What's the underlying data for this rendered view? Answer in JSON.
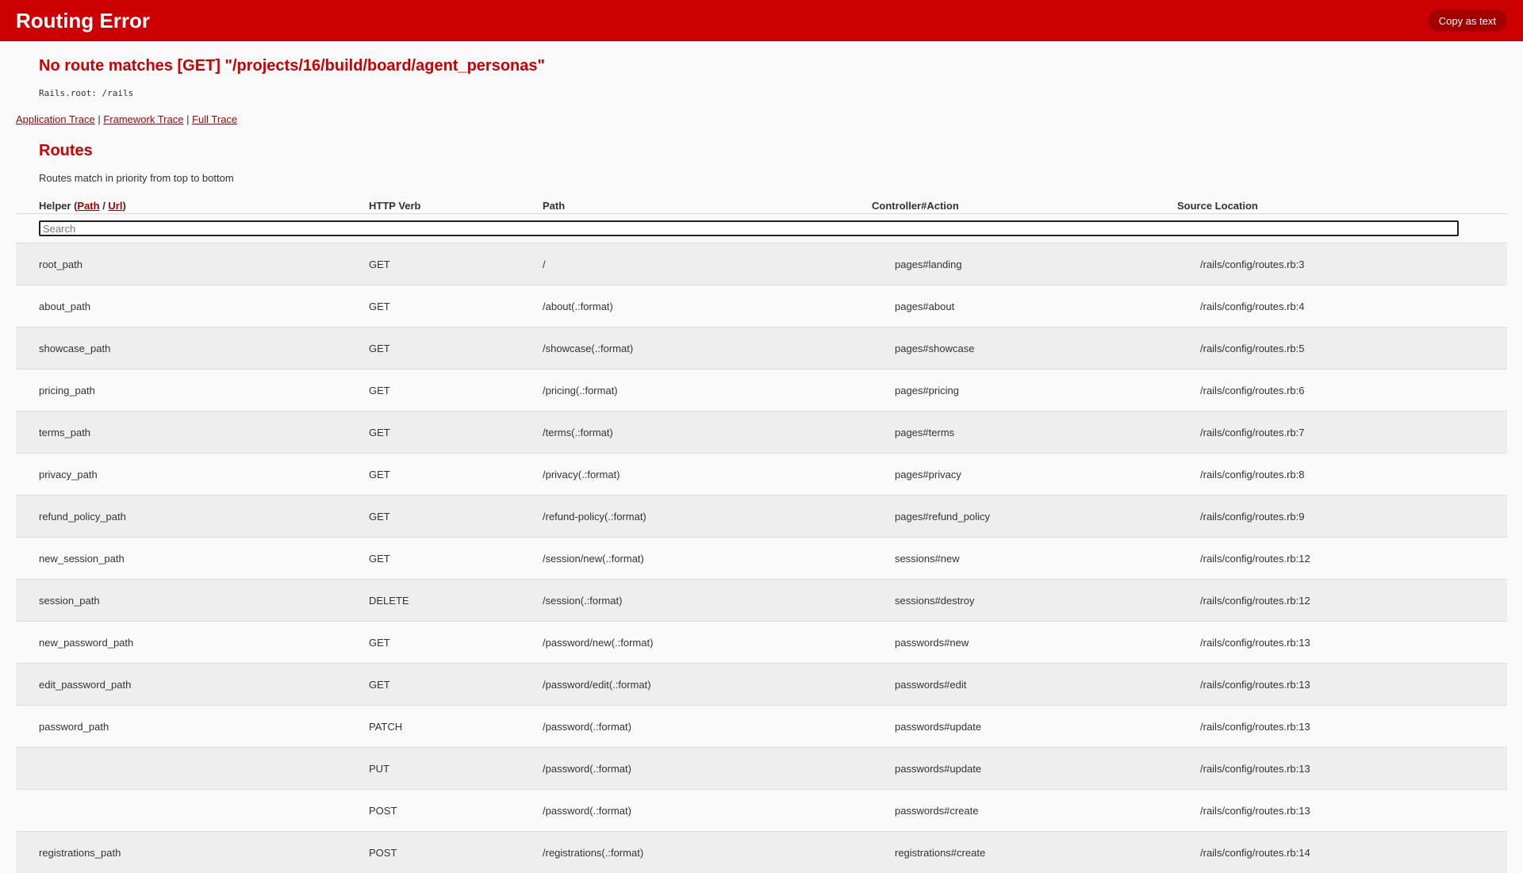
{
  "header": {
    "title": "Routing Error",
    "copy_button": "Copy as text"
  },
  "error": {
    "message": "No route matches [GET] \"/projects/16/build/board/agent_personas\"",
    "rails_root": "Rails.root: /rails"
  },
  "trace_links": {
    "application": "Application Trace",
    "framework": "Framework Trace",
    "full": "Full Trace",
    "separator": " | "
  },
  "routes": {
    "title": "Routes",
    "description": "Routes match in priority from top to bottom",
    "columns": {
      "helper_prefix": "Helper (",
      "helper_path": "Path",
      "helper_sep": " / ",
      "helper_url": "Url",
      "helper_suffix": ")",
      "verb": "HTTP Verb",
      "path": "Path",
      "action": "Controller#Action",
      "source": "Source Location"
    },
    "search_placeholder": "Search",
    "rows": [
      {
        "helper": "root_path",
        "verb": "GET",
        "path": "/",
        "action": "pages#landing",
        "source": "/rails/config/routes.rb:3"
      },
      {
        "helper": "about_path",
        "verb": "GET",
        "path": "/about(.:format)",
        "action": "pages#about",
        "source": "/rails/config/routes.rb:4"
      },
      {
        "helper": "showcase_path",
        "verb": "GET",
        "path": "/showcase(.:format)",
        "action": "pages#showcase",
        "source": "/rails/config/routes.rb:5"
      },
      {
        "helper": "pricing_path",
        "verb": "GET",
        "path": "/pricing(.:format)",
        "action": "pages#pricing",
        "source": "/rails/config/routes.rb:6"
      },
      {
        "helper": "terms_path",
        "verb": "GET",
        "path": "/terms(.:format)",
        "action": "pages#terms",
        "source": "/rails/config/routes.rb:7"
      },
      {
        "helper": "privacy_path",
        "verb": "GET",
        "path": "/privacy(.:format)",
        "action": "pages#privacy",
        "source": "/rails/config/routes.rb:8"
      },
      {
        "helper": "refund_policy_path",
        "verb": "GET",
        "path": "/refund-policy(.:format)",
        "action": "pages#refund_policy",
        "source": "/rails/config/routes.rb:9"
      },
      {
        "helper": "new_session_path",
        "verb": "GET",
        "path": "/session/new(.:format)",
        "action": "sessions#new",
        "source": "/rails/config/routes.rb:12"
      },
      {
        "helper": "session_path",
        "verb": "DELETE",
        "path": "/session(.:format)",
        "action": "sessions#destroy",
        "source": "/rails/config/routes.rb:12"
      },
      {
        "helper": "new_password_path",
        "verb": "GET",
        "path": "/password/new(.:format)",
        "action": "passwords#new",
        "source": "/rails/config/routes.rb:13"
      },
      {
        "helper": "edit_password_path",
        "verb": "GET",
        "path": "/password/edit(.:format)",
        "action": "passwords#edit",
        "source": "/rails/config/routes.rb:13"
      },
      {
        "helper": "password_path",
        "verb": "PATCH",
        "path": "/password(.:format)",
        "action": "passwords#update",
        "source": "/rails/config/routes.rb:13"
      },
      {
        "helper": "",
        "verb": "PUT",
        "path": "/password(.:format)",
        "action": "passwords#update",
        "source": "/rails/config/routes.rb:13"
      },
      {
        "helper": "",
        "verb": "POST",
        "path": "/password(.:format)",
        "action": "passwords#create",
        "source": "/rails/config/routes.rb:13"
      },
      {
        "helper": "registrations_path",
        "verb": "POST",
        "path": "/registrations(.:format)",
        "action": "registrations#create",
        "source": "/rails/config/routes.rb:14"
      }
    ]
  },
  "colors": {
    "header_bg": "#cc0000",
    "accent": "#cc0000",
    "link": "#980905"
  }
}
